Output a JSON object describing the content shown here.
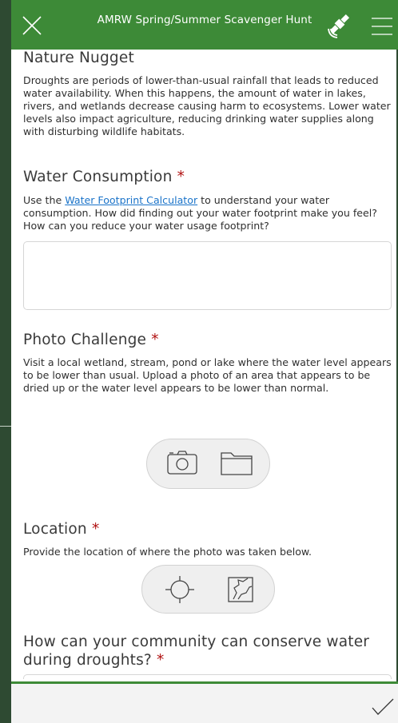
{
  "header": {
    "title": "AMRW Spring/Summer Scavenger Hunt",
    "icons": {
      "close": "close-icon",
      "gps": "satellite-icon",
      "menu": "hamburger-menu-icon"
    }
  },
  "nugget": {
    "title": "Nature Nugget",
    "text": "Droughts are periods of lower-than-usual rainfall that leads to reduced water availability. When this happens, the amount of water in lakes, rivers, and wetlands decrease causing harm to ecosystems. Lower water levels also impact agriculture, reducing drinking water supplies along with disturbing wildlife habitats."
  },
  "water": {
    "title": "Water Consumption",
    "required_mark": "*",
    "text_before": "Use the ",
    "link": "Water Footprint Calculator",
    "text_after": " to understand your water consumption. How did finding out your water footprint make you feel? How can you reduce your water usage footprint?",
    "answer_value": ""
  },
  "photo": {
    "title": "Photo Challenge",
    "required_mark": "*",
    "text": "Visit a local wetland, stream, pond or lake where the water level appears to be lower than usual. Upload a photo of an area that appears to be dried up or the water level appears to be lower than normal.",
    "icons": {
      "camera": "camera-icon",
      "folder": "folder-icon"
    }
  },
  "location": {
    "title": "Location",
    "required_mark": "*",
    "text": "Provide the location of where the photo was taken below.",
    "icons": {
      "locate": "crosshair-icon",
      "map": "map-icon"
    }
  },
  "community": {
    "title_line1": "How can your community can conserve water",
    "title_line2": "during droughts?",
    "required_mark": "*"
  },
  "footer": {
    "icons": {
      "submit": "checkmark-icon"
    }
  },
  "colors": {
    "header": "#3d8a37",
    "required": "#b01010",
    "link": "#1a73c9",
    "side": "#2e4a32"
  }
}
